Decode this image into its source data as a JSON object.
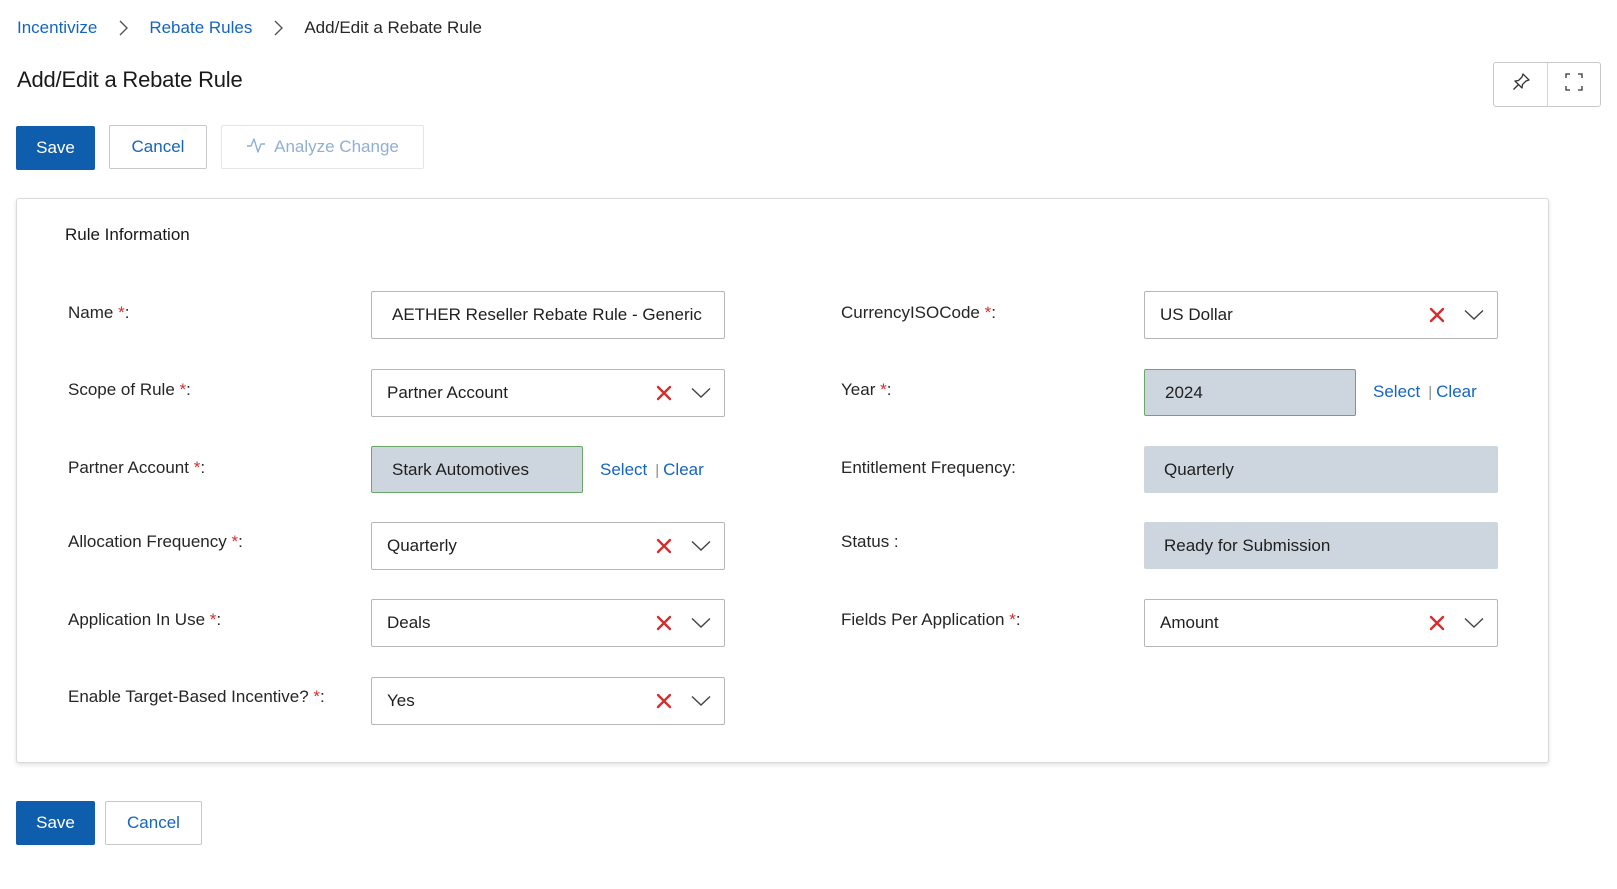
{
  "breadcrumb": {
    "items": [
      "Incentivize",
      "Rebate Rules"
    ],
    "current": "Add/Edit a Rebate Rule"
  },
  "page": {
    "title": "Add/Edit a Rebate Rule"
  },
  "toolbar": {
    "save_label": "Save",
    "cancel_label": "Cancel",
    "analyze_label": "Analyze Change"
  },
  "section": {
    "title": "Rule Information"
  },
  "form": {
    "name": {
      "label": "Name",
      "required": "*",
      "suffix": ":",
      "value": "AETHER Reseller Rebate Rule - Generic"
    },
    "scope": {
      "label": "Scope of Rule",
      "required": "*",
      "suffix": ":",
      "value": "Partner Account"
    },
    "partner_account": {
      "label": "Partner Account",
      "required": "*",
      "suffix": ":",
      "value": "Stark Automotives",
      "select": "Select",
      "clear": "Clear"
    },
    "allocation_frequency": {
      "label": "Allocation Frequency",
      "required": "*",
      "suffix": ":",
      "value": "Quarterly"
    },
    "application_in_use": {
      "label": "Application In Use",
      "required": "*",
      "suffix": ":",
      "value": "Deals"
    },
    "target_based": {
      "label": "Enable Target-Based Incentive?",
      "required": "*",
      "suffix": ":",
      "value": "Yes"
    },
    "currency": {
      "label": "CurrencyISOCode",
      "required": "*",
      "suffix": ":",
      "value": "US Dollar"
    },
    "year": {
      "label": "Year",
      "required": "*",
      "suffix": ":",
      "value": "2024",
      "select": "Select",
      "clear": "Clear"
    },
    "entitlement_frequency": {
      "label": "Entitlement Frequency:",
      "value": "Quarterly"
    },
    "status": {
      "label": "Status :",
      "value": "Ready for Submission"
    },
    "fields_per_application": {
      "label": "Fields Per Application",
      "required": "*",
      "suffix": ":",
      "value": "Amount"
    }
  },
  "colors": {
    "primary": "#0f5ead",
    "link": "#1565c0",
    "required": "#d32f2f",
    "readonly_bg": "#cdd5df",
    "lookup_border": "#6aa86a"
  },
  "icons": {
    "breadcrumb_separator": "chevron-right-icon",
    "pin": "pin-icon",
    "expand": "expand-icon",
    "analyze": "pulse-icon",
    "clear": "close-icon",
    "dropdown": "chevron-down-icon"
  }
}
